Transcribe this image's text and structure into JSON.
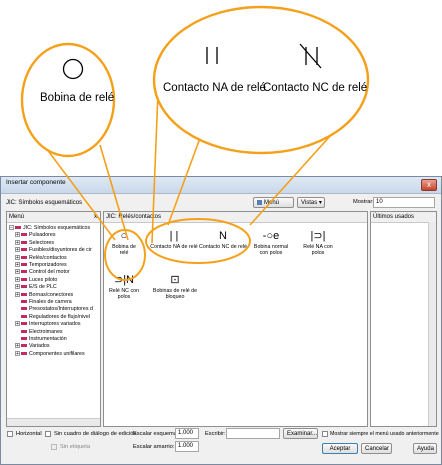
{
  "callouts": {
    "coil_label": "Bobina de relé",
    "no_contact_label": "Contacto NA de relé",
    "nc_contact_label": "Contacto NC de relé",
    "accent_color": "#f5a01a"
  },
  "window": {
    "title": "Insertar componente",
    "close_glyph": "x"
  },
  "toolbar": {
    "library_title": "JIC: Símbolos esquemáticos",
    "menu_label": "Menú",
    "views_label": "Vistas",
    "show_label": "Mostrar:",
    "show_value": "10"
  },
  "menu_panel": {
    "header": "Menú",
    "close_glyph": "x",
    "items": [
      {
        "label": "JIC: Símbolos esquemáticos",
        "exp": "−"
      },
      {
        "label": "Pulsadores",
        "exp": "+"
      },
      {
        "label": "Selectores",
        "exp": "+"
      },
      {
        "label": "Fusibles/disyuntores de cir",
        "exp": "+"
      },
      {
        "label": "Relés/contactos",
        "exp": "+"
      },
      {
        "label": "Temporizadores",
        "exp": "+"
      },
      {
        "label": "Control del motor",
        "exp": "+"
      },
      {
        "label": "Luces piloto",
        "exp": "+"
      },
      {
        "label": "E/S de PLC",
        "exp": "+"
      },
      {
        "label": "Bornas/conectores",
        "exp": "+"
      },
      {
        "label": "Finales de carrera",
        "exp": ""
      },
      {
        "label": "Presostatos/Interruptores d",
        "exp": ""
      },
      {
        "label": "Reguladores de flujo/nivel",
        "exp": ""
      },
      {
        "label": "Interruptores variados",
        "exp": "+"
      },
      {
        "label": "Electroimanes",
        "exp": ""
      },
      {
        "label": "Instrumentación",
        "exp": ""
      },
      {
        "label": "Variados",
        "exp": "+"
      },
      {
        "label": "Componentes unifilares",
        "exp": "+"
      }
    ]
  },
  "symbols_panel": {
    "header": "JIC: Relés/contactos",
    "items": [
      {
        "label": "Bobina de relé",
        "glyph": "○"
      },
      {
        "label": "Contacto NA de relé",
        "glyph": "| |"
      },
      {
        "label": "Contacto NC de relé",
        "glyph": "N"
      },
      {
        "label": "Bobina normal con polos",
        "glyph": "-○e"
      },
      {
        "label": "Relé NA con polos",
        "glyph": "|⊃|"
      },
      {
        "label": "Relé NC con polos",
        "glyph": "⊃|N"
      },
      {
        "label": "Bobinas de relé de bloqueo",
        "glyph": "⊡"
      }
    ]
  },
  "recent_panel": {
    "header": "Últimos usados"
  },
  "bottom": {
    "horizontal_label": "Horizontal",
    "no_edit_dialog_label": "Sin cuadro de diálogo de edición",
    "no_label_label": "Sin etiqueta",
    "scale_schematic_label": "Escalar esquema:",
    "scale_schematic_value": "1.000",
    "scale_ladder_label": "Escalar amarrio:",
    "scale_ladder_value": "1.000",
    "write_label": "Escribir:",
    "write_value": "",
    "browse_label": "Examinar...",
    "always_show_menu_label": "Mostrar siempre el menú usado anteriormente",
    "accept_label": "Aceptar",
    "cancel_label": "Cancelar",
    "help_label": "Ayuda"
  }
}
